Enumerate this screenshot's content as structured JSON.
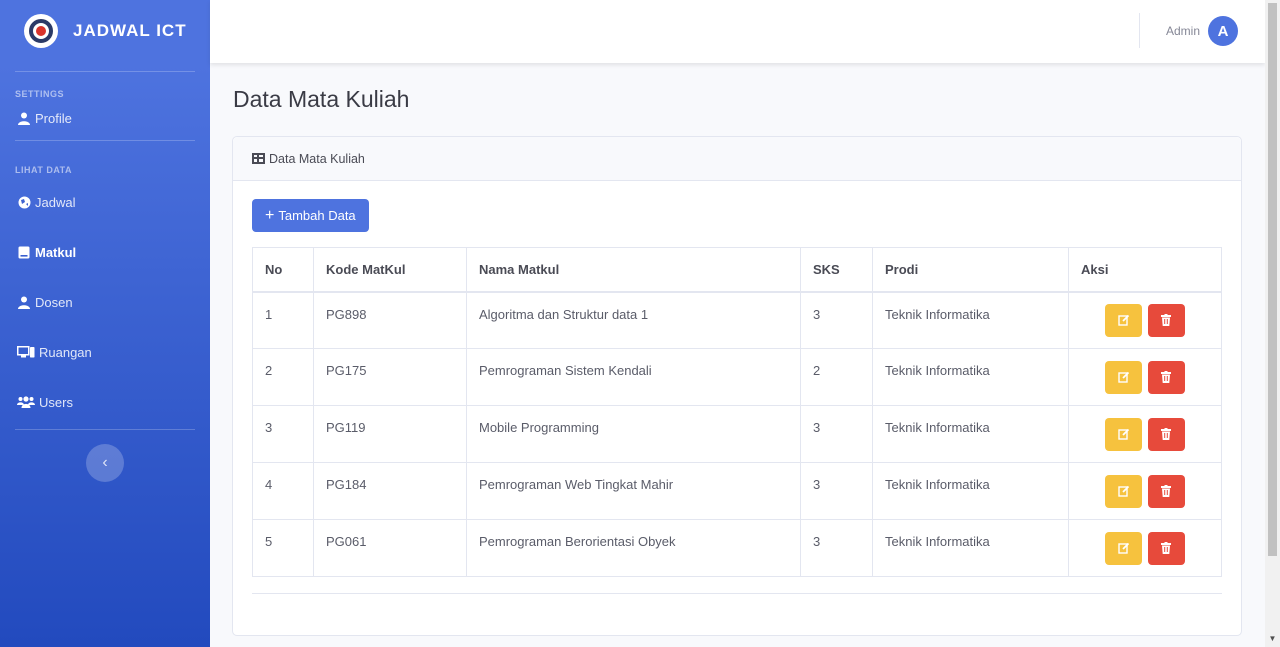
{
  "brand": {
    "name": "JADWAL ICT"
  },
  "sidebar": {
    "settings_heading": "SETTINGS",
    "profile_label": "Profile",
    "lihat_heading": "LIHAT DATA",
    "items": [
      {
        "label": "Jadwal",
        "icon": "globe-icon"
      },
      {
        "label": "Matkul",
        "icon": "book-icon",
        "active": true
      },
      {
        "label": "Dosen",
        "icon": "user-icon"
      },
      {
        "label": "Ruangan",
        "icon": "desktop-icon"
      },
      {
        "label": "Users",
        "icon": "users-icon"
      }
    ],
    "toggle_label": "‹"
  },
  "topbar": {
    "user_name": "Admin",
    "avatar_letter": "A"
  },
  "page": {
    "title": "Data Mata Kuliah",
    "card_title": "Data Mata Kuliah",
    "add_button": "Tambah Data",
    "add_plus": "+"
  },
  "table": {
    "headers": [
      "No",
      "Kode MatKul",
      "Nama Matkul",
      "SKS",
      "Prodi",
      "Aksi"
    ],
    "rows": [
      [
        "1",
        "PG898",
        "Algoritma dan Struktur data 1",
        "3",
        "Teknik Informatika"
      ],
      [
        "2",
        "PG175",
        "Pemrograman Sistem Kendali",
        "2",
        "Teknik Informatika"
      ],
      [
        "3",
        "PG119",
        "Mobile Programming",
        "3",
        "Teknik Informatika"
      ],
      [
        "4",
        "PG184",
        "Pemrograman Web Tingkat Mahir",
        "3",
        "Teknik Informatika"
      ],
      [
        "5",
        "PG061",
        "Pemrograman Berorientasi Obyek",
        "3",
        "Teknik Informatika"
      ]
    ]
  },
  "colors": {
    "primary": "#4e73df",
    "warning": "#f6c23e",
    "danger": "#e74a3b"
  }
}
